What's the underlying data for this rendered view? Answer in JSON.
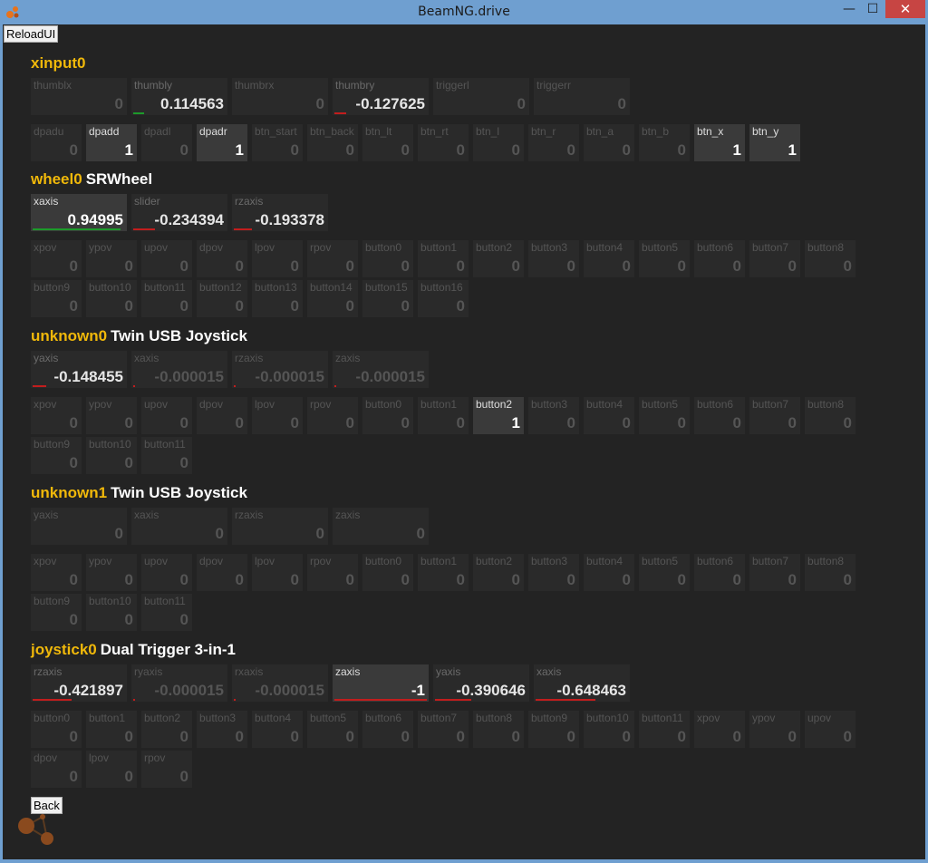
{
  "window": {
    "title": "BeamNG.drive",
    "minimize": "—",
    "maximize": "☐",
    "close": "✕"
  },
  "buttons": {
    "reload": "ReloadUI",
    "back": "Back"
  },
  "colors": {
    "device_id": "#f0b80a",
    "negative_bar": "#c21d1d",
    "positive_bar": "#1c9a2a"
  },
  "devices": [
    {
      "id": "xinput0",
      "name": ""
    },
    {
      "id": "wheel0",
      "name": "SRWheel"
    },
    {
      "id": "unknown0",
      "name": "Twin USB Joystick"
    },
    {
      "id": "unknown1",
      "name": "Twin USB Joystick"
    },
    {
      "id": "joystick0",
      "name": "Dual Trigger 3-in-1"
    }
  ],
  "rows": [
    {
      "device": 0,
      "kind": "axis",
      "cells": [
        {
          "label": "thumblx",
          "value": "0",
          "norm": 0
        },
        {
          "label": "thumbly",
          "value": "0.114563",
          "norm": 0.114563
        },
        {
          "label": "thumbrx",
          "value": "0",
          "norm": 0
        },
        {
          "label": "thumbry",
          "value": "-0.127625",
          "norm": -0.127625
        },
        {
          "label": "triggerl",
          "value": "0",
          "norm": 0
        },
        {
          "label": "triggerr",
          "value": "0",
          "norm": 0
        }
      ]
    },
    {
      "device": 0,
      "kind": "button",
      "cells": [
        {
          "label": "dpadu",
          "value": "0"
        },
        {
          "label": "dpadd",
          "value": "1"
        },
        {
          "label": "dpadl",
          "value": "0"
        },
        {
          "label": "dpadr",
          "value": "1"
        },
        {
          "label": "btn_start",
          "value": "0"
        },
        {
          "label": "btn_back",
          "value": "0"
        },
        {
          "label": "btn_lt",
          "value": "0"
        },
        {
          "label": "btn_rt",
          "value": "0"
        },
        {
          "label": "btn_l",
          "value": "0"
        },
        {
          "label": "btn_r",
          "value": "0"
        },
        {
          "label": "btn_a",
          "value": "0"
        },
        {
          "label": "btn_b",
          "value": "0"
        },
        {
          "label": "btn_x",
          "value": "1"
        },
        {
          "label": "btn_y",
          "value": "1"
        }
      ]
    },
    {
      "device": 1,
      "kind": "axis",
      "cells": [
        {
          "label": "xaxis",
          "value": "0.94995",
          "norm": 0.94995
        },
        {
          "label": "slider",
          "value": "-0.234394",
          "norm": -0.234394
        },
        {
          "label": "rzaxis",
          "value": "-0.193378",
          "norm": -0.193378
        }
      ]
    },
    {
      "device": 1,
      "kind": "button",
      "cells": [
        {
          "label": "xpov",
          "value": "0"
        },
        {
          "label": "ypov",
          "value": "0"
        },
        {
          "label": "upov",
          "value": "0"
        },
        {
          "label": "dpov",
          "value": "0"
        },
        {
          "label": "lpov",
          "value": "0"
        },
        {
          "label": "rpov",
          "value": "0"
        },
        {
          "label": "button0",
          "value": "0"
        },
        {
          "label": "button1",
          "value": "0"
        },
        {
          "label": "button2",
          "value": "0"
        },
        {
          "label": "button3",
          "value": "0"
        },
        {
          "label": "button4",
          "value": "0"
        },
        {
          "label": "button5",
          "value": "0"
        },
        {
          "label": "button6",
          "value": "0"
        },
        {
          "label": "button7",
          "value": "0"
        },
        {
          "label": "button8",
          "value": "0"
        }
      ]
    },
    {
      "device": 1,
      "kind": "button",
      "cells": [
        {
          "label": "button9",
          "value": "0"
        },
        {
          "label": "button10",
          "value": "0"
        },
        {
          "label": "button11",
          "value": "0"
        },
        {
          "label": "button12",
          "value": "0"
        },
        {
          "label": "button13",
          "value": "0"
        },
        {
          "label": "button14",
          "value": "0"
        },
        {
          "label": "button15",
          "value": "0"
        },
        {
          "label": "button16",
          "value": "0"
        }
      ]
    },
    {
      "device": 2,
      "kind": "axis",
      "cells": [
        {
          "label": "yaxis",
          "value": "-0.148455",
          "norm": -0.148455
        },
        {
          "label": "xaxis",
          "value": "-0.000015",
          "norm": -1.5e-05
        },
        {
          "label": "rzaxis",
          "value": "-0.000015",
          "norm": -1.5e-05
        },
        {
          "label": "zaxis",
          "value": "-0.000015",
          "norm": -1.5e-05
        }
      ]
    },
    {
      "device": 2,
      "kind": "button",
      "cells": [
        {
          "label": "xpov",
          "value": "0"
        },
        {
          "label": "ypov",
          "value": "0"
        },
        {
          "label": "upov",
          "value": "0"
        },
        {
          "label": "dpov",
          "value": "0"
        },
        {
          "label": "lpov",
          "value": "0"
        },
        {
          "label": "rpov",
          "value": "0"
        },
        {
          "label": "button0",
          "value": "0"
        },
        {
          "label": "button1",
          "value": "0"
        },
        {
          "label": "button2",
          "value": "1"
        },
        {
          "label": "button3",
          "value": "0"
        },
        {
          "label": "button4",
          "value": "0"
        },
        {
          "label": "button5",
          "value": "0"
        },
        {
          "label": "button6",
          "value": "0"
        },
        {
          "label": "button7",
          "value": "0"
        },
        {
          "label": "button8",
          "value": "0"
        }
      ]
    },
    {
      "device": 2,
      "kind": "button",
      "cells": [
        {
          "label": "button9",
          "value": "0"
        },
        {
          "label": "button10",
          "value": "0"
        },
        {
          "label": "button11",
          "value": "0"
        }
      ]
    },
    {
      "device": 3,
      "kind": "axis",
      "cells": [
        {
          "label": "yaxis",
          "value": "0",
          "norm": 0
        },
        {
          "label": "xaxis",
          "value": "0",
          "norm": 0
        },
        {
          "label": "rzaxis",
          "value": "0",
          "norm": 0
        },
        {
          "label": "zaxis",
          "value": "0",
          "norm": 0
        }
      ]
    },
    {
      "device": 3,
      "kind": "button",
      "cells": [
        {
          "label": "xpov",
          "value": "0"
        },
        {
          "label": "ypov",
          "value": "0"
        },
        {
          "label": "upov",
          "value": "0"
        },
        {
          "label": "dpov",
          "value": "0"
        },
        {
          "label": "lpov",
          "value": "0"
        },
        {
          "label": "rpov",
          "value": "0"
        },
        {
          "label": "button0",
          "value": "0"
        },
        {
          "label": "button1",
          "value": "0"
        },
        {
          "label": "button2",
          "value": "0"
        },
        {
          "label": "button3",
          "value": "0"
        },
        {
          "label": "button4",
          "value": "0"
        },
        {
          "label": "button5",
          "value": "0"
        },
        {
          "label": "button6",
          "value": "0"
        },
        {
          "label": "button7",
          "value": "0"
        },
        {
          "label": "button8",
          "value": "0"
        }
      ]
    },
    {
      "device": 3,
      "kind": "button",
      "cells": [
        {
          "label": "button9",
          "value": "0"
        },
        {
          "label": "button10",
          "value": "0"
        },
        {
          "label": "button11",
          "value": "0"
        }
      ]
    },
    {
      "device": 4,
      "kind": "axis",
      "cells": [
        {
          "label": "rzaxis",
          "value": "-0.421897",
          "norm": -0.421897
        },
        {
          "label": "ryaxis",
          "value": "-0.000015",
          "norm": -1.5e-05
        },
        {
          "label": "rxaxis",
          "value": "-0.000015",
          "norm": -1.5e-05
        },
        {
          "label": "zaxis",
          "value": "-1",
          "norm": -1
        },
        {
          "label": "yaxis",
          "value": "-0.390646",
          "norm": -0.390646
        },
        {
          "label": "xaxis",
          "value": "-0.648463",
          "norm": -0.648463
        }
      ]
    },
    {
      "device": 4,
      "kind": "button",
      "cells": [
        {
          "label": "button0",
          "value": "0"
        },
        {
          "label": "button1",
          "value": "0"
        },
        {
          "label": "button2",
          "value": "0"
        },
        {
          "label": "button3",
          "value": "0"
        },
        {
          "label": "button4",
          "value": "0"
        },
        {
          "label": "button5",
          "value": "0"
        },
        {
          "label": "button6",
          "value": "0"
        },
        {
          "label": "button7",
          "value": "0"
        },
        {
          "label": "button8",
          "value": "0"
        },
        {
          "label": "button9",
          "value": "0"
        },
        {
          "label": "button10",
          "value": "0"
        },
        {
          "label": "button11",
          "value": "0"
        },
        {
          "label": "xpov",
          "value": "0"
        },
        {
          "label": "ypov",
          "value": "0"
        },
        {
          "label": "upov",
          "value": "0"
        }
      ]
    },
    {
      "device": 4,
      "kind": "button",
      "cells": [
        {
          "label": "dpov",
          "value": "0"
        },
        {
          "label": "lpov",
          "value": "0"
        },
        {
          "label": "rpov",
          "value": "0"
        }
      ]
    }
  ]
}
